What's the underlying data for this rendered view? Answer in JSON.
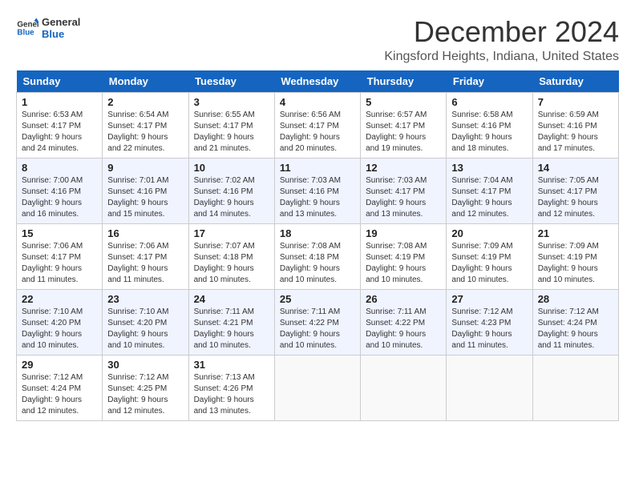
{
  "logo": {
    "line1": "General",
    "line2": "Blue"
  },
  "title": "December 2024",
  "location": "Kingsford Heights, Indiana, United States",
  "weekdays": [
    "Sunday",
    "Monday",
    "Tuesday",
    "Wednesday",
    "Thursday",
    "Friday",
    "Saturday"
  ],
  "weeks": [
    [
      {
        "day": "1",
        "sunrise": "6:53 AM",
        "sunset": "4:17 PM",
        "daylight": "9 hours and 24 minutes."
      },
      {
        "day": "2",
        "sunrise": "6:54 AM",
        "sunset": "4:17 PM",
        "daylight": "9 hours and 22 minutes."
      },
      {
        "day": "3",
        "sunrise": "6:55 AM",
        "sunset": "4:17 PM",
        "daylight": "9 hours and 21 minutes."
      },
      {
        "day": "4",
        "sunrise": "6:56 AM",
        "sunset": "4:17 PM",
        "daylight": "9 hours and 20 minutes."
      },
      {
        "day": "5",
        "sunrise": "6:57 AM",
        "sunset": "4:17 PM",
        "daylight": "9 hours and 19 minutes."
      },
      {
        "day": "6",
        "sunrise": "6:58 AM",
        "sunset": "4:16 PM",
        "daylight": "9 hours and 18 minutes."
      },
      {
        "day": "7",
        "sunrise": "6:59 AM",
        "sunset": "4:16 PM",
        "daylight": "9 hours and 17 minutes."
      }
    ],
    [
      {
        "day": "8",
        "sunrise": "7:00 AM",
        "sunset": "4:16 PM",
        "daylight": "9 hours and 16 minutes."
      },
      {
        "day": "9",
        "sunrise": "7:01 AM",
        "sunset": "4:16 PM",
        "daylight": "9 hours and 15 minutes."
      },
      {
        "day": "10",
        "sunrise": "7:02 AM",
        "sunset": "4:16 PM",
        "daylight": "9 hours and 14 minutes."
      },
      {
        "day": "11",
        "sunrise": "7:03 AM",
        "sunset": "4:16 PM",
        "daylight": "9 hours and 13 minutes."
      },
      {
        "day": "12",
        "sunrise": "7:03 AM",
        "sunset": "4:17 PM",
        "daylight": "9 hours and 13 minutes."
      },
      {
        "day": "13",
        "sunrise": "7:04 AM",
        "sunset": "4:17 PM",
        "daylight": "9 hours and 12 minutes."
      },
      {
        "day": "14",
        "sunrise": "7:05 AM",
        "sunset": "4:17 PM",
        "daylight": "9 hours and 12 minutes."
      }
    ],
    [
      {
        "day": "15",
        "sunrise": "7:06 AM",
        "sunset": "4:17 PM",
        "daylight": "9 hours and 11 minutes."
      },
      {
        "day": "16",
        "sunrise": "7:06 AM",
        "sunset": "4:17 PM",
        "daylight": "9 hours and 11 minutes."
      },
      {
        "day": "17",
        "sunrise": "7:07 AM",
        "sunset": "4:18 PM",
        "daylight": "9 hours and 10 minutes."
      },
      {
        "day": "18",
        "sunrise": "7:08 AM",
        "sunset": "4:18 PM",
        "daylight": "9 hours and 10 minutes."
      },
      {
        "day": "19",
        "sunrise": "7:08 AM",
        "sunset": "4:19 PM",
        "daylight": "9 hours and 10 minutes."
      },
      {
        "day": "20",
        "sunrise": "7:09 AM",
        "sunset": "4:19 PM",
        "daylight": "9 hours and 10 minutes."
      },
      {
        "day": "21",
        "sunrise": "7:09 AM",
        "sunset": "4:19 PM",
        "daylight": "9 hours and 10 minutes."
      }
    ],
    [
      {
        "day": "22",
        "sunrise": "7:10 AM",
        "sunset": "4:20 PM",
        "daylight": "9 hours and 10 minutes."
      },
      {
        "day": "23",
        "sunrise": "7:10 AM",
        "sunset": "4:20 PM",
        "daylight": "9 hours and 10 minutes."
      },
      {
        "day": "24",
        "sunrise": "7:11 AM",
        "sunset": "4:21 PM",
        "daylight": "9 hours and 10 minutes."
      },
      {
        "day": "25",
        "sunrise": "7:11 AM",
        "sunset": "4:22 PM",
        "daylight": "9 hours and 10 minutes."
      },
      {
        "day": "26",
        "sunrise": "7:11 AM",
        "sunset": "4:22 PM",
        "daylight": "9 hours and 10 minutes."
      },
      {
        "day": "27",
        "sunrise": "7:12 AM",
        "sunset": "4:23 PM",
        "daylight": "9 hours and 11 minutes."
      },
      {
        "day": "28",
        "sunrise": "7:12 AM",
        "sunset": "4:24 PM",
        "daylight": "9 hours and 11 minutes."
      }
    ],
    [
      {
        "day": "29",
        "sunrise": "7:12 AM",
        "sunset": "4:24 PM",
        "daylight": "9 hours and 12 minutes."
      },
      {
        "day": "30",
        "sunrise": "7:12 AM",
        "sunset": "4:25 PM",
        "daylight": "9 hours and 12 minutes."
      },
      {
        "day": "31",
        "sunrise": "7:13 AM",
        "sunset": "4:26 PM",
        "daylight": "9 hours and 13 minutes."
      },
      null,
      null,
      null,
      null
    ]
  ]
}
